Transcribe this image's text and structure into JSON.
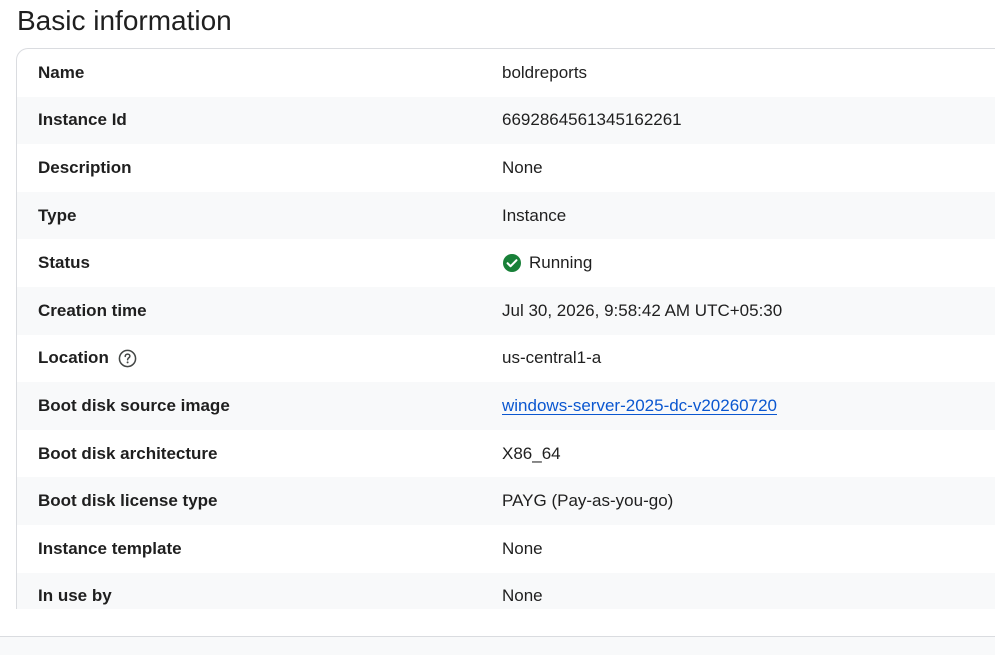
{
  "section": {
    "title": "Basic information"
  },
  "rows": [
    {
      "label": "Name",
      "value": "boldreports"
    },
    {
      "label": "Instance Id",
      "value": "6692864561345162261"
    },
    {
      "label": "Description",
      "value": "None"
    },
    {
      "label": "Type",
      "value": "Instance"
    },
    {
      "label": "Status",
      "value": "Running",
      "icon": "check-circle-icon",
      "icon_color": "#188038"
    },
    {
      "label": "Creation time",
      "value": "Jul 30, 2026, 9:58:42 AM UTC+05:30"
    },
    {
      "label": "Location",
      "value": "us-central1-a",
      "label_icon": "help-circle-icon"
    },
    {
      "label": "Boot disk source image",
      "value": "windows-server-2025-dc-v20260720",
      "link_color": "#0b57d0"
    },
    {
      "label": "Boot disk architecture",
      "value": "X86_64"
    },
    {
      "label": "Boot disk license type",
      "value": "PAYG (Pay-as-you-go)"
    },
    {
      "label": "Instance template",
      "value": "None"
    },
    {
      "label": "In use by",
      "value": "None"
    }
  ]
}
